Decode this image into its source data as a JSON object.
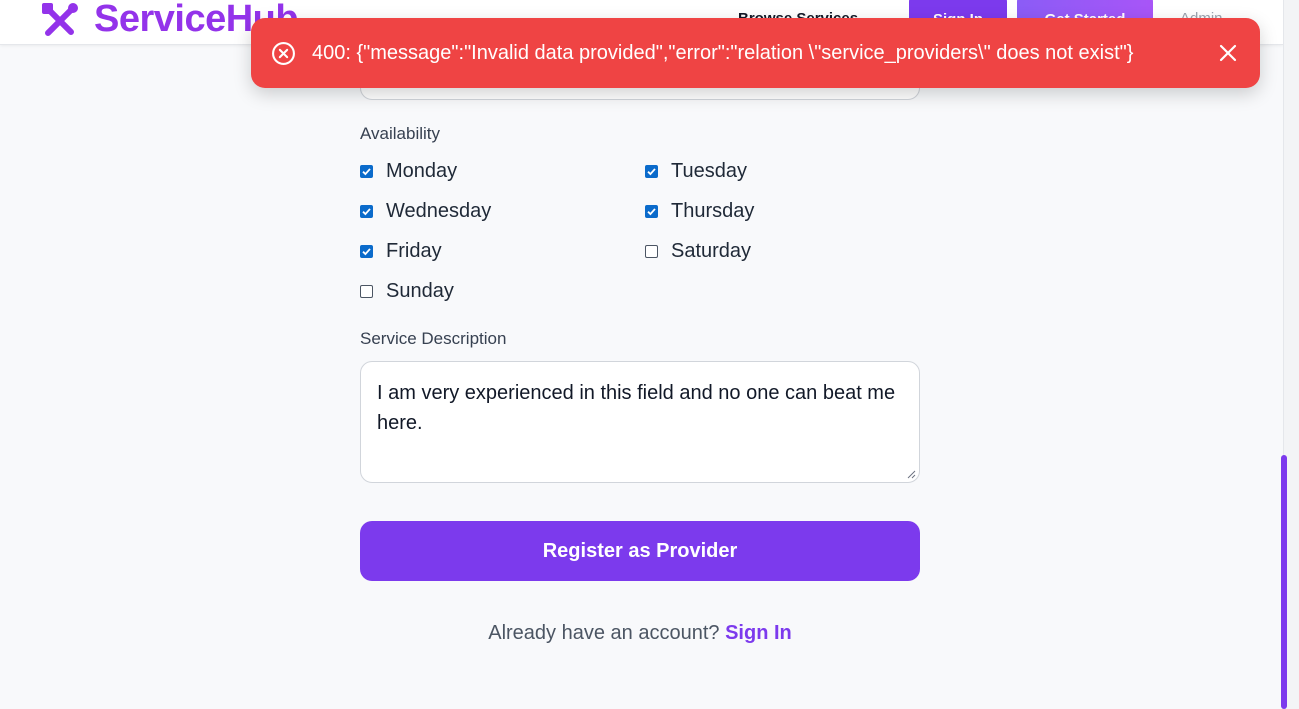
{
  "header": {
    "logo_text": "ServiceHub",
    "nav_link": "Browse Services",
    "signin_label": "Sign In",
    "get_started_label": "Get Started",
    "admin_label": "Admin"
  },
  "toast": {
    "message": "400: {\"message\":\"Invalid data provided\",\"error\":\"relation \\\"service_providers\\\" does not exist\"}",
    "color": "#ef4444"
  },
  "form": {
    "availability_label": "Availability",
    "days": [
      {
        "label": "Monday",
        "checked": true
      },
      {
        "label": "Tuesday",
        "checked": true
      },
      {
        "label": "Wednesday",
        "checked": true
      },
      {
        "label": "Thursday",
        "checked": true
      },
      {
        "label": "Friday",
        "checked": true
      },
      {
        "label": "Saturday",
        "checked": false
      },
      {
        "label": "Sunday",
        "checked": false
      }
    ],
    "description_label": "Service Description",
    "description_value": "I am very experienced in this field and no one can beat me here.",
    "submit_label": "Register as Provider",
    "signin_prompt": "Already have an account?",
    "signin_link": "Sign In"
  },
  "colors": {
    "accent": "#7c3aed",
    "brand": "#9333ea",
    "checkbox": "#0b6bcb"
  }
}
